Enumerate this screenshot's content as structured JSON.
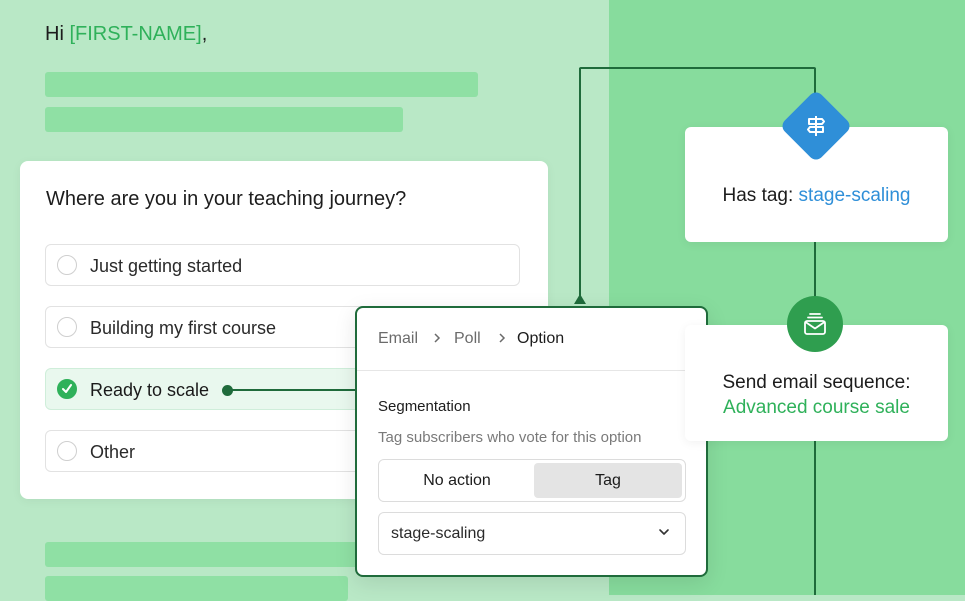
{
  "greeting": {
    "prefix": "Hi ",
    "first_name": "[FIRST-NAME]",
    "suffix": ","
  },
  "poll": {
    "question": "Where are you in your teaching journey?",
    "options": [
      {
        "label": "Just getting started",
        "selected": false
      },
      {
        "label": "Building my first course",
        "selected": false
      },
      {
        "label": "Ready to scale",
        "selected": true
      },
      {
        "label": "Other",
        "selected": false
      }
    ]
  },
  "option_panel": {
    "breadcrumb": [
      "Email",
      "Poll",
      "Option"
    ],
    "section_title": "Segmentation",
    "section_subtitle": "Tag subscribers who vote for this option",
    "toggle": {
      "options": [
        "No action",
        "Tag"
      ],
      "selected": "Tag"
    },
    "tag_select": {
      "value": "stage-scaling"
    }
  },
  "workflow": {
    "condition": {
      "label": "Has tag: ",
      "value": "stage-scaling",
      "icon": "signpost-icon"
    },
    "action": {
      "label": "Send email sequence:",
      "value": "Advanced course sale",
      "icon": "mail-stack-icon"
    }
  },
  "colors": {
    "accent_green": "#2fb15a",
    "dark_green": "#1f6b3b",
    "accent_blue": "#2f8fd8",
    "background_light": "#b9e8c6",
    "background_right": "#87dc9d"
  }
}
